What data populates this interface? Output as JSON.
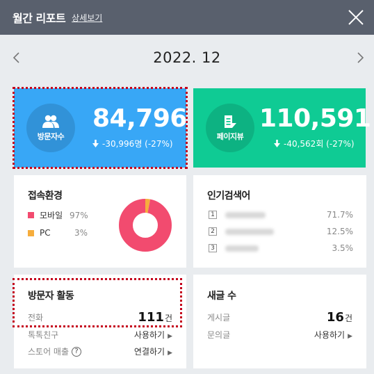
{
  "header": {
    "title": "월간 리포트",
    "detail_link": "상세보기"
  },
  "nav": {
    "month": "2022. 12"
  },
  "visitors": {
    "label": "방문자수",
    "value": "84,796",
    "delta": "-30,996명 (-27%)"
  },
  "pageviews": {
    "label": "페이지뷰",
    "value": "110,591",
    "delta": "-40,562회 (-27%)"
  },
  "access": {
    "title": "접속환경",
    "items": [
      {
        "name": "모바일",
        "pct": "97%",
        "color": "#f24b6f",
        "share": 0.97
      },
      {
        "name": "PC",
        "pct": "3%",
        "color": "#f6ad3c",
        "share": 0.03
      }
    ]
  },
  "keywords": {
    "title": "인기검색어",
    "items": [
      {
        "rank": "1",
        "pct": "71.7%"
      },
      {
        "rank": "2",
        "pct": "12.5%"
      },
      {
        "rank": "3",
        "pct": "3.5%"
      }
    ]
  },
  "activity": {
    "title": "방문자 활동",
    "call_label": "전화",
    "call_value": "111",
    "call_unit": "건",
    "talk_label": "톡톡친구",
    "talk_action": "사용하기",
    "store_label": "스토어 매출",
    "store_action": "연결하기"
  },
  "posts": {
    "title": "새글 수",
    "post_label": "게시글",
    "post_value": "16",
    "post_unit": "건",
    "inquiry_label": "문의글",
    "inquiry_action": "사용하기"
  },
  "colors": {
    "header_bg": "#59606d",
    "visitors_bg": "#38a7f6",
    "pageviews_bg": "#0fcb94",
    "highlight_dots": "#c4001c"
  }
}
